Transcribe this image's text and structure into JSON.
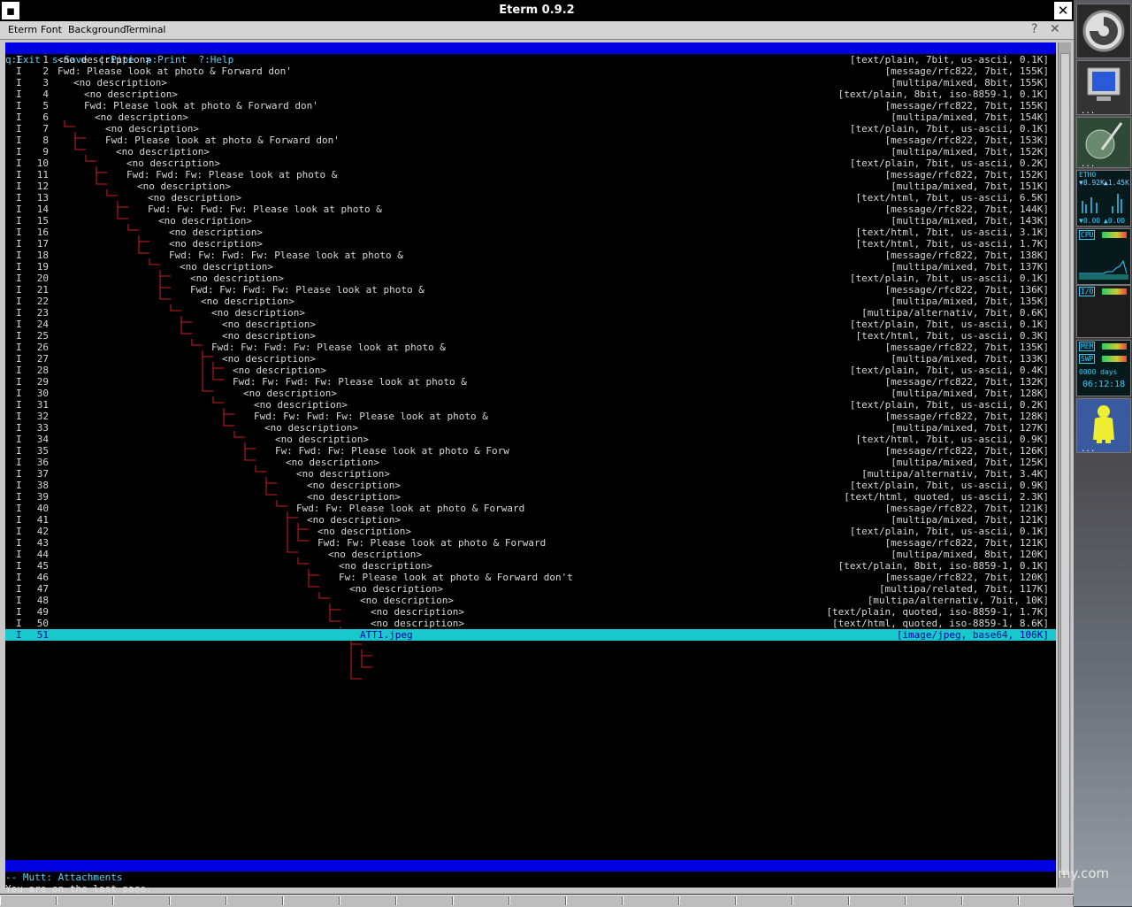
{
  "window": {
    "title": "Eterm 0.9.2"
  },
  "menubar": {
    "items": [
      "Eterm",
      "Font",
      "Background",
      "Terminal"
    ],
    "help": "?",
    "close": "✕"
  },
  "helpbar": {
    "text": "q:Exit  s:Save  |:Pipe  p:Print  ?:Help"
  },
  "attachments": [
    {
      "flag": "I",
      "num": "1",
      "text": "<no description>",
      "info": "[text/plain, 7bit, us-ascii, 0.1K]"
    },
    {
      "flag": "I",
      "num": "2",
      "text": "Fwd: Please look at photo & Forward don'",
      "info": "[message/rfc822, 7bit, 155K]"
    },
    {
      "flag": "I",
      "num": "3",
      "text": "<no description>",
      "info": "[multipa/mixed, 8bit, 155K]"
    },
    {
      "flag": "I",
      "num": "4",
      "text": "<no description>",
      "info": "[text/plain, 8bit, iso-8859-1, 0.1K]"
    },
    {
      "flag": "I",
      "num": "5",
      "text": "Fwd: Please look at photo & Forward don'",
      "info": "[message/rfc822, 7bit, 155K]"
    },
    {
      "flag": "I",
      "num": "6",
      "text": "<no description>",
      "info": "[multipa/mixed, 7bit, 154K]"
    },
    {
      "flag": "I",
      "num": "7",
      "text": "<no description>",
      "info": "[text/plain, 7bit, us-ascii, 0.1K]"
    },
    {
      "flag": "I",
      "num": "8",
      "text": "Fwd: Please look at photo & Forward don'",
      "info": "[message/rfc822, 7bit, 153K]"
    },
    {
      "flag": "I",
      "num": "9",
      "text": "<no description>",
      "info": "[multipa/mixed, 7bit, 152K]"
    },
    {
      "flag": "I",
      "num": "10",
      "text": "<no description>",
      "info": "[text/plain, 7bit, us-ascii, 0.2K]"
    },
    {
      "flag": "I",
      "num": "11",
      "text": "Fwd: Fwd: Fw: Please look at photo &",
      "info": "[message/rfc822, 7bit, 152K]"
    },
    {
      "flag": "I",
      "num": "12",
      "text": "<no description>",
      "info": "[multipa/mixed, 7bit, 151K]"
    },
    {
      "flag": "I",
      "num": "13",
      "text": "<no description>",
      "info": "[text/html, 7bit, us-ascii, 6.5K]"
    },
    {
      "flag": "I",
      "num": "14",
      "text": "Fwd: Fw: Fwd: Fw: Please look at photo &",
      "info": "[message/rfc822, 7bit, 144K]"
    },
    {
      "flag": "I",
      "num": "15",
      "text": "<no description>",
      "info": "[multipa/mixed, 7bit, 143K]"
    },
    {
      "flag": "I",
      "num": "16",
      "text": "<no description>",
      "info": "[text/html, 7bit, us-ascii, 3.1K]"
    },
    {
      "flag": "I",
      "num": "17",
      "text": "<no description>",
      "info": "[text/html, 7bit, us-ascii, 1.7K]"
    },
    {
      "flag": "I",
      "num": "18",
      "text": "Fwd: Fw: Fwd: Fw: Please look at photo &",
      "info": "[message/rfc822, 7bit, 138K]"
    },
    {
      "flag": "I",
      "num": "19",
      "text": "<no description>",
      "info": "[multipa/mixed, 7bit, 137K]"
    },
    {
      "flag": "I",
      "num": "20",
      "text": "<no description>",
      "info": "[text/plain, 7bit, us-ascii, 0.1K]"
    },
    {
      "flag": "I",
      "num": "21",
      "text": "Fwd: Fw: Fwd: Fw: Please look at photo &",
      "info": "[message/rfc822, 7bit, 136K]"
    },
    {
      "flag": "I",
      "num": "22",
      "text": "<no description>",
      "info": "[multipa/mixed, 7bit, 135K]"
    },
    {
      "flag": "I",
      "num": "23",
      "text": "<no description>",
      "info": "[multipa/alternativ, 7bit, 0.6K]"
    },
    {
      "flag": "I",
      "num": "24",
      "text": "<no description>",
      "info": "[text/plain, 7bit, us-ascii, 0.1K]"
    },
    {
      "flag": "I",
      "num": "25",
      "text": "<no description>",
      "info": "[text/html, 7bit, us-ascii, 0.3K]"
    },
    {
      "flag": "I",
      "num": "26",
      "text": "Fwd: Fw: Fwd: Fw: Please look at photo &",
      "info": "[message/rfc822, 7bit, 135K]"
    },
    {
      "flag": "I",
      "num": "27",
      "text": "<no description>",
      "info": "[multipa/mixed, 7bit, 133K]"
    },
    {
      "flag": "I",
      "num": "28",
      "text": "<no description>",
      "info": "[text/plain, 7bit, us-ascii, 0.4K]"
    },
    {
      "flag": "I",
      "num": "29",
      "text": "Fwd: Fw: Fwd: Fw: Please look at photo &",
      "info": "[message/rfc822, 7bit, 132K]"
    },
    {
      "flag": "I",
      "num": "30",
      "text": "<no description>",
      "info": "[multipa/mixed, 7bit, 128K]"
    },
    {
      "flag": "I",
      "num": "31",
      "text": "<no description>",
      "info": "[text/plain, 7bit, us-ascii, 0.2K]"
    },
    {
      "flag": "I",
      "num": "32",
      "text": "Fwd: Fw: Fwd: Fw: Please look at photo &",
      "info": "[message/rfc822, 7bit, 128K]"
    },
    {
      "flag": "I",
      "num": "33",
      "text": "<no description>",
      "info": "[multipa/mixed, 7bit, 127K]"
    },
    {
      "flag": "I",
      "num": "34",
      "text": "<no description>",
      "info": "[text/html, 7bit, us-ascii, 0.9K]"
    },
    {
      "flag": "I",
      "num": "35",
      "text": "Fw: Fwd: Fw: Please look at photo & Forw",
      "info": "[message/rfc822, 7bit, 126K]"
    },
    {
      "flag": "I",
      "num": "36",
      "text": "<no description>",
      "info": "[multipa/mixed, 7bit, 125K]"
    },
    {
      "flag": "I",
      "num": "37",
      "text": "<no description>",
      "info": "[multipa/alternativ, 7bit, 3.4K]"
    },
    {
      "flag": "I",
      "num": "38",
      "text": "<no description>",
      "info": "[text/plain, 7bit, us-ascii, 0.9K]"
    },
    {
      "flag": "I",
      "num": "39",
      "text": "<no description>",
      "info": "[text/html, quoted, us-ascii, 2.3K]"
    },
    {
      "flag": "I",
      "num": "40",
      "text": "Fwd: Fw: Please look at photo & Forward",
      "info": "[message/rfc822, 7bit, 121K]"
    },
    {
      "flag": "I",
      "num": "41",
      "text": "<no description>",
      "info": "[multipa/mixed, 7bit, 121K]"
    },
    {
      "flag": "I",
      "num": "42",
      "text": "<no description>",
      "info": "[text/plain, 7bit, us-ascii, 0.1K]"
    },
    {
      "flag": "I",
      "num": "43",
      "text": "Fwd: Fw: Please look at photo & Forward",
      "info": "[message/rfc822, 7bit, 121K]"
    },
    {
      "flag": "I",
      "num": "44",
      "text": "<no description>",
      "info": "[multipa/mixed, 8bit, 120K]"
    },
    {
      "flag": "I",
      "num": "45",
      "text": "<no description>",
      "info": "[text/plain, 8bit, iso-8859-1, 0.1K]"
    },
    {
      "flag": "I",
      "num": "46",
      "text": "Fw: Please look at photo & Forward don't",
      "info": "[message/rfc822, 7bit, 120K]"
    },
    {
      "flag": "I",
      "num": "47",
      "text": "<no description>",
      "info": "[multipa/related, 7bit, 117K]"
    },
    {
      "flag": "I",
      "num": "48",
      "text": "<no description>",
      "info": "[multipa/alternativ, 7bit, 10K]"
    },
    {
      "flag": "I",
      "num": "49",
      "text": "<no description>",
      "info": "[text/plain, quoted, iso-8859-1, 1.7K]"
    },
    {
      "flag": "I",
      "num": "50",
      "text": "<no description>",
      "info": "[text/html, quoted, iso-8859-1, 8.6K]"
    },
    {
      "flag": "I",
      "num": "51",
      "text": "ATT1.jpeg",
      "info": "[image/jpeg, base64, 106K]"
    }
  ],
  "statusbar": {
    "text": "-- Mutt: Attachments"
  },
  "message": {
    "text": "You are on the last page."
  },
  "dock": {
    "net_label": "ETH0",
    "net_in": "▼8.92K",
    "net_out": "▲1.45K",
    "net_low_a": "▼0.00",
    "net_low_b": "▲0.00",
    "cpu_label": "CPU",
    "io_label": "I/O",
    "mem_label": "MEM",
    "swp_label": "SWP",
    "uptime_days": "0000 days",
    "uptime_time": "06:12:18",
    "dots": "..."
  },
  "watermark": "my.com"
}
